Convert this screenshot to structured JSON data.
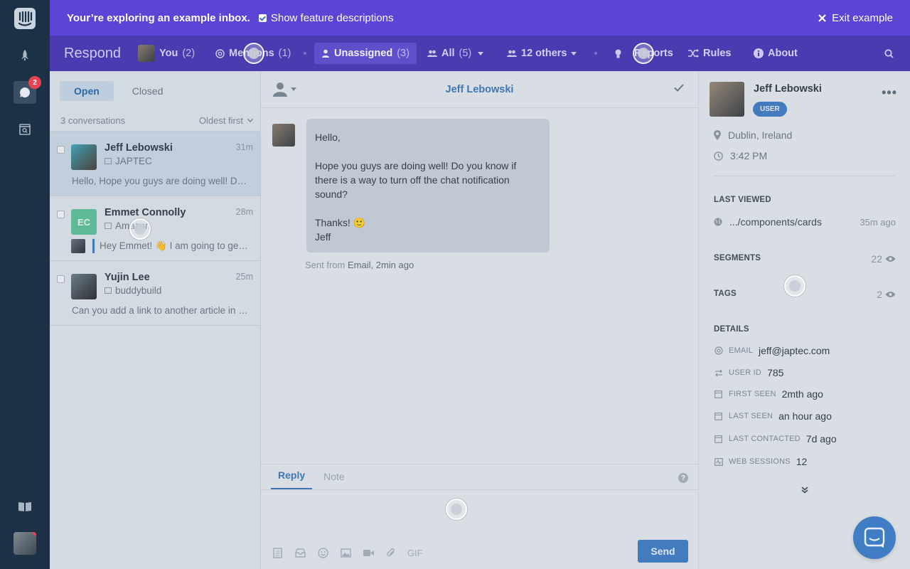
{
  "rail": {
    "badge_count": "2"
  },
  "banner": {
    "title": "Your’re exploring an example inbox.",
    "checkbox_label": "Show feature descriptions",
    "exit_label": "Exit example"
  },
  "topnav": {
    "brand": "Respond",
    "you_label": "You",
    "you_count": "(2)",
    "mentions_label": "Mentions",
    "mentions_count": "(1)",
    "unassigned_label": "Unassigned",
    "unassigned_count": "(3)",
    "all_label": "All",
    "all_count": "(5)",
    "others_label": "12 others",
    "reports_label": "Reports",
    "rules_label": "Rules",
    "about_label": "About"
  },
  "list": {
    "tab_open": "Open",
    "tab_closed": "Closed",
    "count_label": "3 conversations",
    "sort_label": "Oldest first",
    "conversations": [
      {
        "name": "Jeff Lebowski",
        "company": "JAPTEC",
        "time": "31m",
        "preview": "Hello, Hope you guys are doing well! Do you know if"
      },
      {
        "name": "Emmet Connolly",
        "initials": "EC",
        "company": "Amazon",
        "time": "28m",
        "preview": "Hey Emmet! 👋 I am going to get back to you"
      },
      {
        "name": "Yujin Lee",
        "company": "buddybuild",
        "time": "25m",
        "preview": "Can you add a link to another article in the help"
      }
    ]
  },
  "conversation": {
    "title": "Jeff Lebowski",
    "message": {
      "line1": "Hello,",
      "line2": "Hope you guys are doing well! Do you know if there is a way to turn off the chat notification sound?",
      "line3": "Thanks! 🙂",
      "line4": "Jeff"
    },
    "sent_prefix": "Sent from",
    "sent_via": "Email,",
    "sent_time": "2min ago",
    "reply_tab": "Reply",
    "note_tab": "Note",
    "help": "?",
    "gif_label": "GIF",
    "send_label": "Send"
  },
  "profile": {
    "name": "Jeff Lebowski",
    "badge": "USER",
    "location": "Dublin, Ireland",
    "local_time": "3:42 PM",
    "last_viewed_label": "LAST VIEWED",
    "last_viewed_page": ".../components/cards",
    "last_viewed_time": "35m ago",
    "segments_label": "SEGMENTS",
    "segments_count": "22",
    "tags_label": "TAGS",
    "tags_count": "2",
    "details_label": "DETAILS",
    "details": [
      {
        "key": "EMAIL",
        "value": "jeff@japtec.com",
        "icon": "at-icon"
      },
      {
        "key": "USER ID",
        "value": "785",
        "icon": "id-icon"
      },
      {
        "key": "FIRST SEEN",
        "value": "2mth ago",
        "icon": "calendar-icon"
      },
      {
        "key": "LAST SEEN",
        "value": "an hour ago",
        "icon": "calendar-icon"
      },
      {
        "key": "LAST CONTACTED",
        "value": "7d ago",
        "icon": "calendar-icon"
      },
      {
        "key": "WEB SESSIONS",
        "value": "12",
        "icon": "sessions-icon"
      }
    ]
  },
  "colors": {
    "banner": "#5a45d6",
    "topnav": "#4a3cb0",
    "rail": "#1c3046",
    "accent": "#3f7dc4",
    "badge_red": "#e84350",
    "avatar_ec": "#5fbf9a"
  }
}
